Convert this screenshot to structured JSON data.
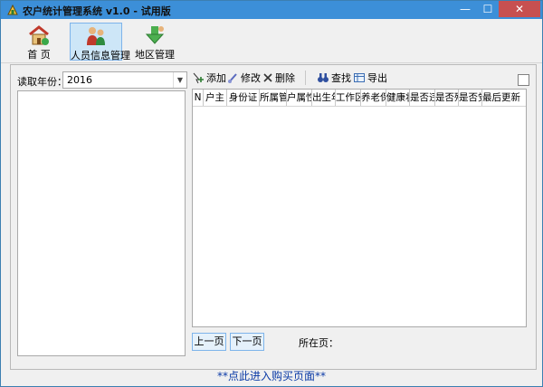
{
  "window": {
    "title": "农户统计管理系统 v1.0 - 试用版",
    "controls": {
      "minimize": "—",
      "maximize": "☐",
      "close": "✕"
    }
  },
  "toolbar": {
    "items": [
      {
        "label": "首 页",
        "icon": "house-icon"
      },
      {
        "label": "人员信息管理",
        "icon": "people-icon",
        "active": true
      },
      {
        "label": "地区管理",
        "icon": "region-download-icon"
      }
    ]
  },
  "left_panel": {
    "year_label": "读取年份：",
    "year_value": "2016"
  },
  "actions": {
    "add": "添加",
    "edit": "修改",
    "delete": "删除",
    "find": "查找",
    "export": "导出"
  },
  "table": {
    "columns": [
      "N",
      "户主",
      "身份证",
      "所属管辖",
      "户属性",
      "出生年月",
      "工作区域",
      "养老保险",
      "健康状况",
      "是否违法",
      "是否残疾",
      "是否党员",
      "最后更新时间"
    ],
    "rows": []
  },
  "pager": {
    "prev": "上一页",
    "next": "下一页",
    "current_label": "所在页："
  },
  "footer": {
    "buy_link": "**点此进入购买页面**"
  },
  "colors": {
    "titlebar": "#3c8fd8",
    "close_button": "#c75050",
    "active_tool": "#cde6f7",
    "buy_link": "#0b3aa6"
  }
}
